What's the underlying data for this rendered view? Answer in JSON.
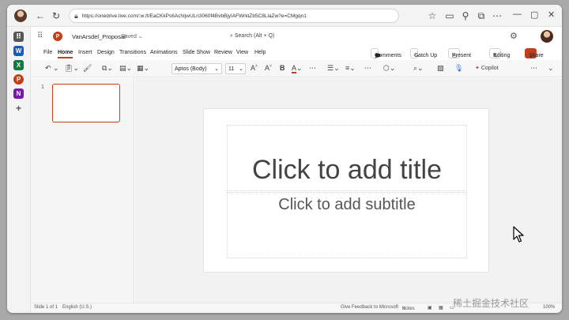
{
  "browser": {
    "url": "https://onedrive.live.com/:w:/t/EaCKkPs6AchIjwULn3060f4BvbBjyIAFWrktZb5C8LlaZw?e=CMgqn1"
  },
  "app": {
    "file_name": "VanArsdel_Proposal",
    "save_status": "Saved",
    "search_placeholder": "Search (Alt + Q)"
  },
  "menu": {
    "tabs": [
      "File",
      "Home",
      "Insert",
      "Design",
      "Transitions",
      "Animations",
      "Slide Show",
      "Review",
      "View",
      "Help"
    ],
    "active_tab": "Home"
  },
  "ribbon": {
    "comments": "Comments",
    "catch_up": "Catch Up",
    "present": "Present",
    "editing": "Editing",
    "share": "Share",
    "font_name": "Aptos (Body)",
    "font_size": "11",
    "copilot": "Copilot"
  },
  "slides": {
    "count_label": "1",
    "title_placeholder": "Click to add title",
    "subtitle_placeholder": "Click to add subtitle"
  },
  "status": {
    "slide_info": "Slide 1 of 1",
    "language": "English (U.S.)",
    "feedback": "Give Feedback to Microsoft",
    "notes": "Notes",
    "zoom": "100%"
  },
  "watermark": "稀土掘金技术社区",
  "colors": {
    "accent": "#c43e1c",
    "background": "#f2f2f2"
  }
}
